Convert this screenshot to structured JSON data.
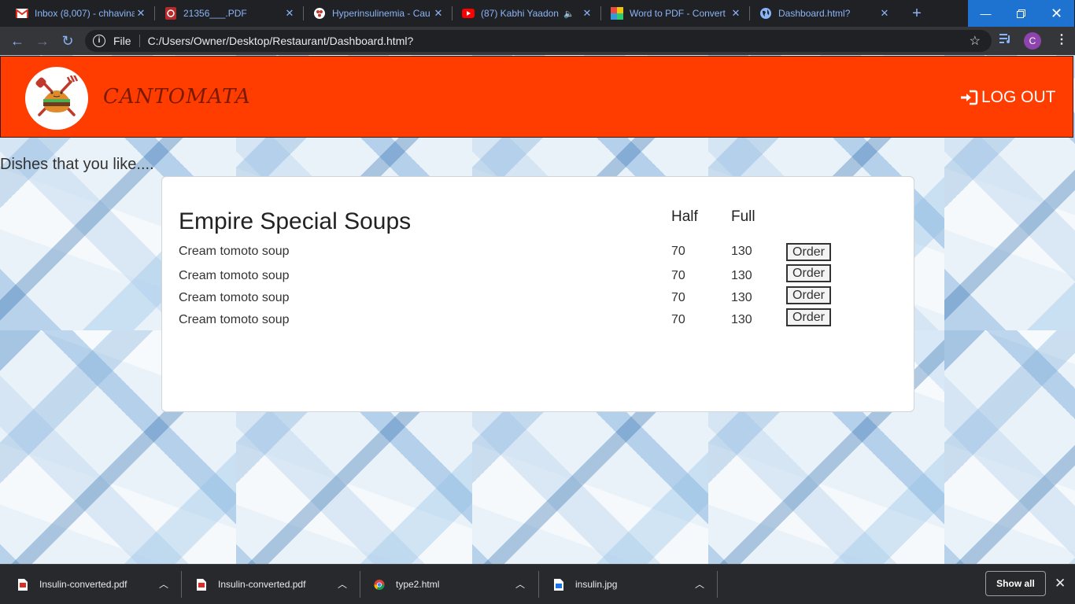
{
  "browser": {
    "tabs": [
      {
        "title": "Inbox (8,007) - chhavina",
        "icon": "gmail-icon",
        "color": "#d93025"
      },
      {
        "title": "21356___.PDF",
        "icon": "pdf-icon",
        "color": "#d93025"
      },
      {
        "title": "Hyperinsulinemia - Cau",
        "icon": "site-icon",
        "color": "#c0392b"
      },
      {
        "title": "(87) Kabhi Yaadon",
        "icon": "youtube-icon",
        "color": "#ff0000"
      },
      {
        "title": "Word to PDF - Convert",
        "icon": "ilovepdf-icon",
        "color": "#e67e22"
      },
      {
        "title": "Dashboard.html?",
        "icon": "globe-icon",
        "color": "#8ab4f8"
      }
    ],
    "new_tab": "+",
    "address": {
      "scheme": "File",
      "url": "C:/Users/Owner/Desktop/Restaurant/Dashboard.html?"
    },
    "profile_initial": "C"
  },
  "app": {
    "brand": "CANTOMATA",
    "logout_label": "LOG OUT",
    "subtitle": "Dishes that you like....",
    "accent_color": "#ff3d00",
    "menu": {
      "section_title": "Empire Special Soups",
      "col_half": "Half",
      "col_full": "Full",
      "items": [
        {
          "name": "Cream tomoto soup",
          "half": "70",
          "full": "130",
          "action": "Order"
        },
        {
          "name": "Cream tomoto soup",
          "half": "70",
          "full": "130",
          "action": "Order"
        },
        {
          "name": "Cream tomoto soup",
          "half": "70",
          "full": "130",
          "action": "Order"
        },
        {
          "name": "Cream tomoto soup",
          "half": "70",
          "full": "130",
          "action": "Order"
        }
      ]
    }
  },
  "downloads": {
    "items": [
      {
        "name": "Insulin-converted.pdf",
        "type": "pdf"
      },
      {
        "name": "Insulin-converted.pdf",
        "type": "pdf"
      },
      {
        "name": "type2.html",
        "type": "chrome"
      },
      {
        "name": "insulin.jpg",
        "type": "image"
      }
    ],
    "show_all": "Show all"
  }
}
